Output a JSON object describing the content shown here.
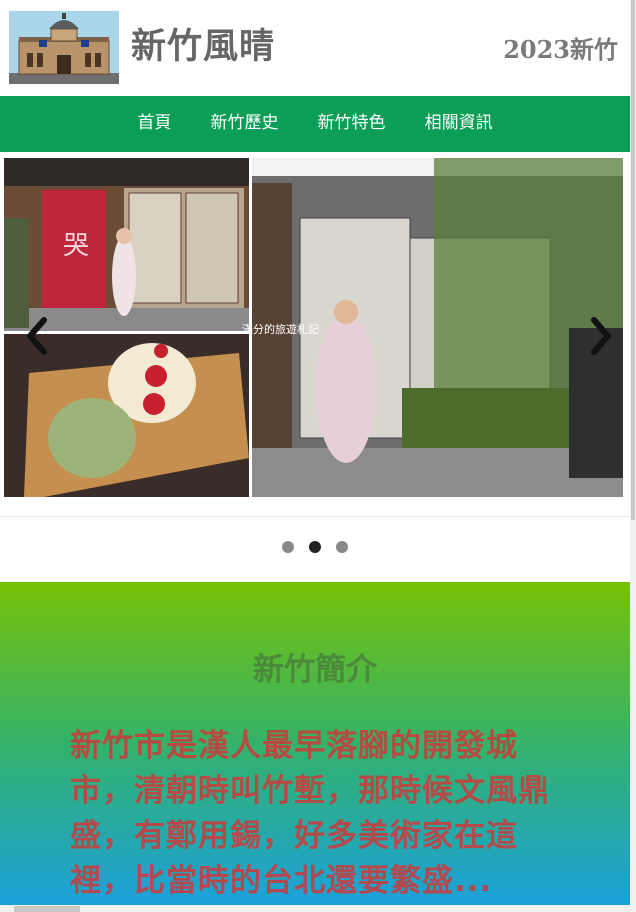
{
  "header": {
    "logo_icon": "hsinchu-station-logo",
    "site_title": "新竹風晴",
    "year_label": "2023新竹"
  },
  "nav": {
    "items": [
      {
        "label": "首頁"
      },
      {
        "label": "新竹歷史"
      },
      {
        "label": "新竹特色"
      },
      {
        "label": "相關資訊"
      }
    ],
    "color": "#0a9e56"
  },
  "carousel": {
    "slide_image": "photo-collage-japanese-house-and-pastries",
    "prev_icon": "chevron-left-icon",
    "next_icon": "chevron-right-icon",
    "photo_sign_text": "哭",
    "watermark_text": "滿分的旅遊札記",
    "dots": 3,
    "active_index": 1
  },
  "intro": {
    "title": "新竹簡介",
    "body": "新竹市是漢人最早落腳的開發城市，清朝時叫竹塹，那時候文風鼎盛，有鄭用錫，好多美術家在這裡，比當時的台北還要繁盛...",
    "gradient": [
      "#77c108",
      "#1aa0e0"
    ]
  }
}
